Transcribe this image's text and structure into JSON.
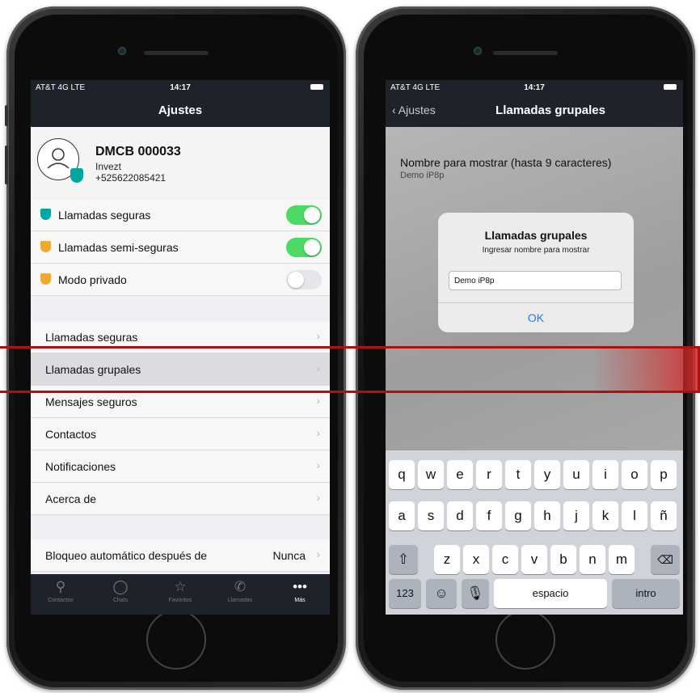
{
  "left": {
    "status": {
      "carrier": "AT&T 4G  LTE",
      "time": "14:17"
    },
    "nav_title": "Ajustes",
    "profile": {
      "name": "DMCB 000033",
      "company": "Invezt",
      "phone": "+525622085421"
    },
    "toggles": [
      {
        "label": "Llamadas seguras",
        "on": true,
        "shield_color": "#00a7a0"
      },
      {
        "label": "Llamadas semi-seguras",
        "on": true,
        "shield_color": "#f0a830"
      },
      {
        "label": "Modo  privado",
        "on": false,
        "shield_color": "#f0a830"
      }
    ],
    "menu": [
      "Llamadas seguras",
      "Llamadas grupales",
      "Mensajes seguros",
      "Contactos",
      "Notificaciones",
      "Acerca de"
    ],
    "autolock": {
      "label": "Bloqueo automático después de",
      "value": "Nunca"
    },
    "tabs": [
      "Contactos",
      "Chats",
      "Favoritos",
      "Llamadas",
      "Más"
    ]
  },
  "right": {
    "status": {
      "carrier": "AT&T 4G  LTE",
      "time": "14:17"
    },
    "nav": {
      "back": "Ajustes",
      "title": "Llamadas grupales"
    },
    "field": {
      "title": "Nombre para mostrar (hasta 9 caracteres)",
      "value": "Demo iP8p"
    },
    "alert": {
      "title": "Llamadas grupales",
      "message": "Ingresar nombre para mostrar",
      "input_value": "Demo iP8p",
      "ok": "OK"
    },
    "keyboard": {
      "row1": [
        "q",
        "w",
        "e",
        "r",
        "t",
        "y",
        "u",
        "i",
        "o",
        "p"
      ],
      "row2": [
        "a",
        "s",
        "d",
        "f",
        "g",
        "h",
        "j",
        "k",
        "l",
        "ñ"
      ],
      "row3": [
        "z",
        "x",
        "c",
        "v",
        "b",
        "n",
        "m"
      ],
      "numbers": "123",
      "space": "espacio",
      "return": "intro"
    }
  },
  "colors": {
    "toggle_on": "#4cd964",
    "highlight": "#b01010",
    "nav_bg": "#1e222a",
    "ios_blue": "#147efb"
  }
}
